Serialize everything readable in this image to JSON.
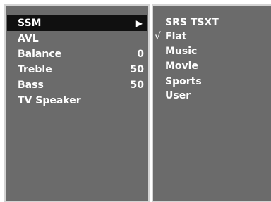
{
  "menu": {
    "items": [
      {
        "label": "SSM",
        "value": "",
        "arrow": "▶"
      },
      {
        "label": "AVL",
        "value": ""
      },
      {
        "label": "Balance",
        "value": "0"
      },
      {
        "label": "Treble",
        "value": "50"
      },
      {
        "label": "Bass",
        "value": "50"
      },
      {
        "label": "TV Speaker",
        "value": ""
      }
    ],
    "selected_index": 0
  },
  "submenu": {
    "check_mark": "√",
    "items": [
      {
        "label": "SRS TSXT"
      },
      {
        "label": "Flat"
      },
      {
        "label": "Music"
      },
      {
        "label": "Movie"
      },
      {
        "label": "Sports"
      },
      {
        "label": "User"
      }
    ],
    "checked_index": 1
  },
  "colors": {
    "panel_bg": "#6b6b6b",
    "selected_bg": "#101010",
    "border": "#d4d4d4",
    "text": "#ffffff"
  }
}
